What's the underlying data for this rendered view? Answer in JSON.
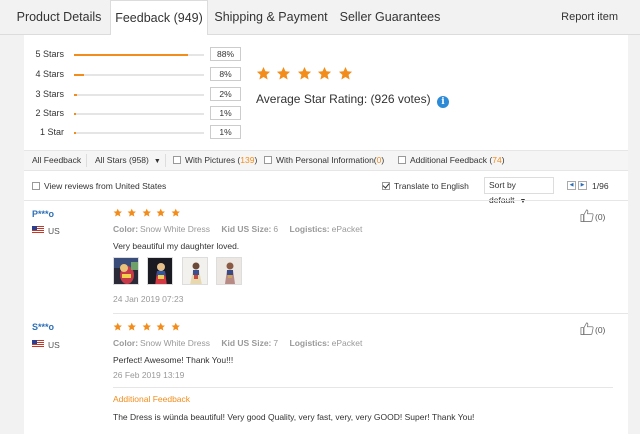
{
  "tabs": [
    {
      "label": "Product Details",
      "active": false
    },
    {
      "label": "Feedback (949)",
      "active": true
    },
    {
      "label": "Shipping & Payment",
      "active": false
    },
    {
      "label": "Seller Guarantees",
      "active": false
    }
  ],
  "report_label": "Report item",
  "rating_summary": {
    "rows": [
      {
        "label": "5 Stars",
        "percent_text": "88%",
        "percent": 88
      },
      {
        "label": "4 Stars",
        "percent_text": "8%",
        "percent": 8
      },
      {
        "label": "3 Stars",
        "percent_text": "2%",
        "percent": 2
      },
      {
        "label": "2 Stars",
        "percent_text": "1%",
        "percent": 1
      },
      {
        "label": "1 Star",
        "percent_text": "1%",
        "percent": 1
      }
    ],
    "average_label": "Average Star Rating:",
    "votes_text": "(926 votes)",
    "stars_filled": 5,
    "star_color": "#f28c1b",
    "info_icon": "i"
  },
  "filters": {
    "all_feedback": "All Feedback",
    "all_stars": "All Stars (958)",
    "with_pictures_label": "With Pictures (",
    "with_pictures_count": "139",
    "with_personal_label": "With Personal Information(",
    "with_personal_count": "0",
    "additional_label": "Additional Feedback (",
    "additional_count": "74",
    "close_paren": ")"
  },
  "subbar": {
    "view_us_label": "View reviews from United States",
    "view_us_checked": false,
    "translate_label": "Translate to English",
    "translate_checked": true,
    "sort_label": "Sort by default",
    "page_text": "1/96"
  },
  "reviews": [
    {
      "user": "P***o",
      "country": "US",
      "stars": 5,
      "color_label": "Color:",
      "color_value": "Snow White Dress",
      "size_label": "Kid US Size:",
      "size_value": "6",
      "logistics_label": "Logistics:",
      "logistics_value": "ePacket",
      "text": "Very beautiful my daughter loved.",
      "photos": 4,
      "date": "24 Jan 2019 07:23",
      "likes": "(0)"
    },
    {
      "user": "S***o",
      "country": "US",
      "stars": 5,
      "color_label": "Color:",
      "color_value": "Snow White Dress",
      "size_label": "Kid US Size:",
      "size_value": "7",
      "logistics_label": "Logistics:",
      "logistics_value": "ePacket",
      "text": "Perfect! Awesome! Thank You!!!",
      "date": "26 Feb 2019 13:19",
      "likes": "(0)",
      "additional_title": "Additional Feedback",
      "additional_text": "The Dress is wünda beautiful! Very good Quality, very fast, very, very GOOD! Super! Thank You!"
    }
  ]
}
